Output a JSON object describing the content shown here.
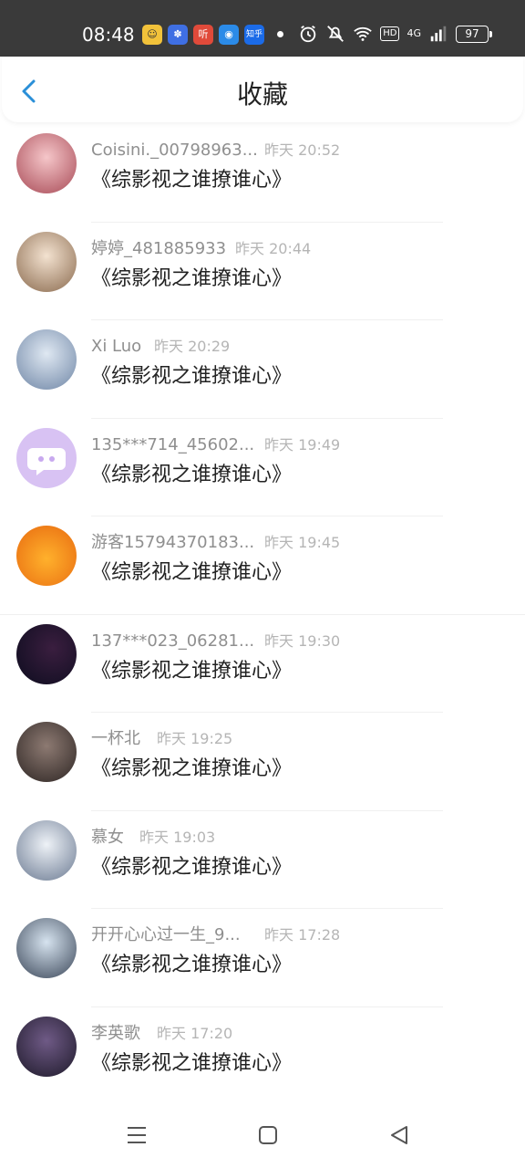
{
  "status_bar": {
    "time": "08:48",
    "battery": "97",
    "hd_label": "HD",
    "network_label": "4G",
    "app_icons": [
      {
        "name": "app-icon-1",
        "glyph": "☺",
        "color": "#f2c23a"
      },
      {
        "name": "app-icon-baidu",
        "glyph": "✽",
        "color": "#3f6fe3"
      },
      {
        "name": "app-icon-listen",
        "glyph": "听",
        "color": "#e04a3a"
      },
      {
        "name": "app-icon-4",
        "glyph": "◉",
        "color": "#2b8be8"
      },
      {
        "name": "app-icon-zhihu",
        "glyph": "知乎",
        "color": "#1b6be8"
      }
    ]
  },
  "header": {
    "title": "收藏"
  },
  "list": [
    {
      "name": "Coisini._00798963...",
      "time": "昨天 20:52",
      "content": "《综影视之谁撩谁心》",
      "avatar": [
        "#f5c6c9",
        "#a84a56"
      ]
    },
    {
      "name": "婷婷_481885933",
      "time": "昨天 20:44",
      "content": "《综影视之谁撩谁心》",
      "avatar": [
        "#f3e2d0",
        "#8a6a4e"
      ]
    },
    {
      "name": "Xi Luo",
      "time": "昨天 20:29",
      "content": "《综影视之谁撩谁心》",
      "avatar": [
        "#dfe8f2",
        "#6f86a6"
      ]
    },
    {
      "name": "135***714_45602...",
      "time": "昨天 19:49",
      "content": "《综影视之谁撩谁心》",
      "avatar": [
        "#d8c2f3",
        "#c8a9ef"
      ]
    },
    {
      "name": "游客15794370183...",
      "time": "昨天 19:45",
      "content": "《综影视之谁撩谁心》",
      "avatar": [
        "#ffb12c",
        "#e86a10"
      ]
    },
    {
      "name": "137***023_06281...",
      "time": "昨天 19:30",
      "content": "《综影视之谁撩谁心》",
      "avatar": [
        "#3a1e3f",
        "#0c0c1e"
      ]
    },
    {
      "name": "一杯北",
      "time": "昨天 19:25",
      "content": "《综影视之谁撩谁心》",
      "avatar": [
        "#8d7a72",
        "#2e2624"
      ]
    },
    {
      "name": "慕女",
      "time": "昨天 19:03",
      "content": "《综影视之谁撩谁心》",
      "avatar": [
        "#eef2f7",
        "#6b7a92"
      ]
    },
    {
      "name": "开开心心过一生_9...",
      "time": "昨天 17:28",
      "content": "《综影视之谁撩谁心》",
      "avatar": [
        "#d6e3ef",
        "#3a4658"
      ]
    },
    {
      "name": "李英歌",
      "time": "昨天 17:20",
      "content": "《综影视之谁撩谁心》",
      "avatar": [
        "#6f5a86",
        "#1e1a2a"
      ]
    }
  ]
}
